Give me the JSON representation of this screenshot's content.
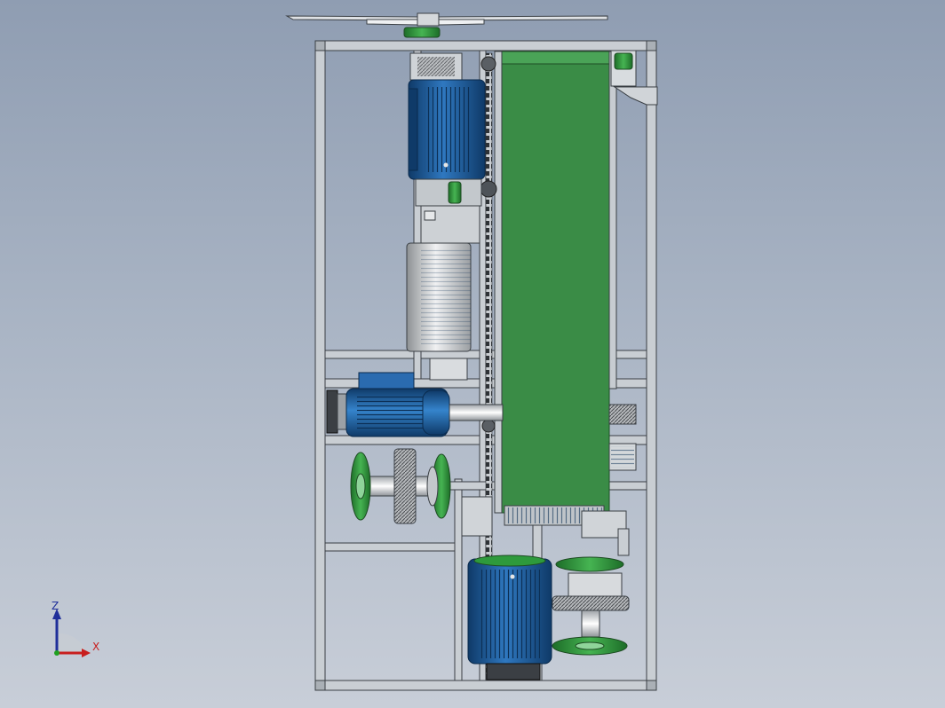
{
  "view": {
    "background_top": "#8f9db2",
    "background_bottom": "#c8ced8"
  },
  "colors": {
    "frame": "#c9ced3",
    "frame_edge": "#3a3f44",
    "belt": "#3a8c46",
    "motor": "#1f5fa0",
    "motor_dark": "#123f6e",
    "pulley_green": "#2e9a3c",
    "gearbox": "#d6d8da",
    "axis_x": "#c81e1e",
    "axis_y": "#1fa01f",
    "axis_z": "#1f2f9a"
  },
  "components": [
    {
      "name": "outer-frame"
    },
    {
      "name": "top-fan-blade"
    },
    {
      "name": "conveyor-belt"
    },
    {
      "name": "upper-motor"
    },
    {
      "name": "gear-reducer"
    },
    {
      "name": "middle-motor"
    },
    {
      "name": "pulley-assembly"
    },
    {
      "name": "lower-motor"
    },
    {
      "name": "lower-pulley-assembly"
    },
    {
      "name": "drive-chain"
    }
  ],
  "triad": {
    "z_label": "Z",
    "x_label": "X"
  }
}
